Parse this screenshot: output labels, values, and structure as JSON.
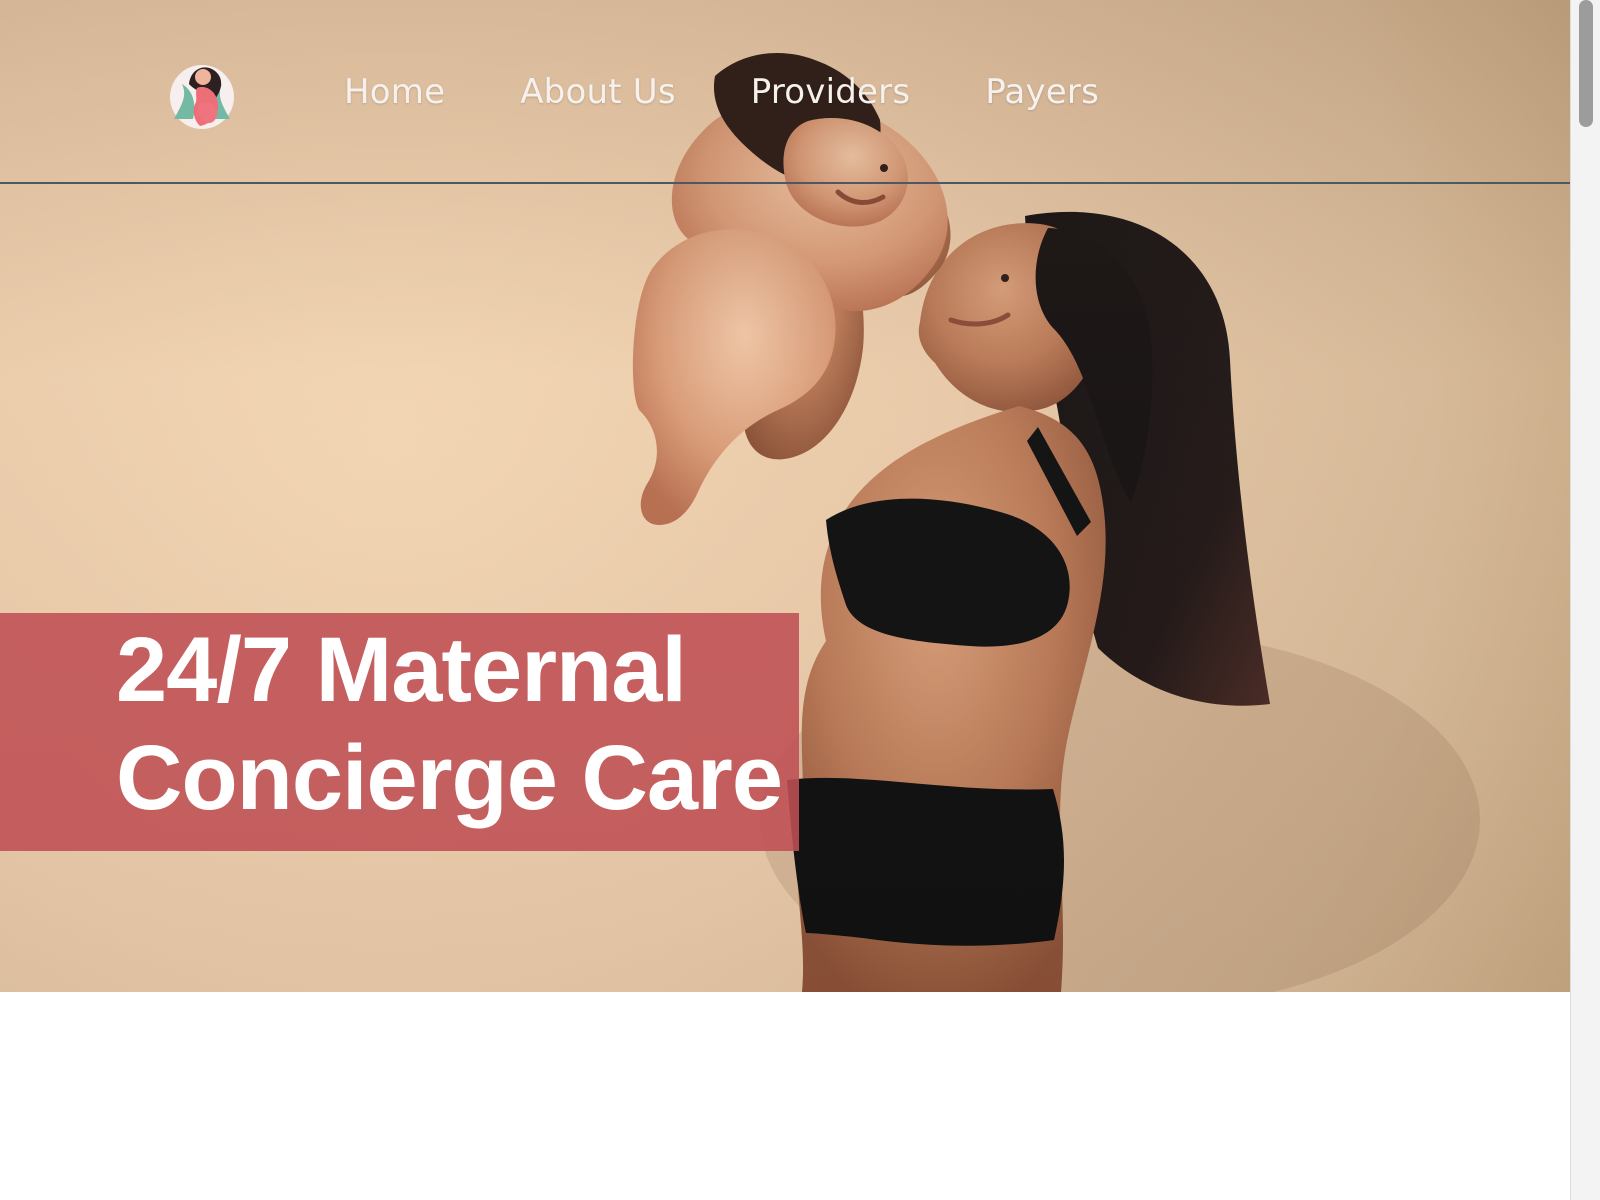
{
  "site": {
    "logo_icon": "pregnant-woman-logo-icon"
  },
  "nav": {
    "items": [
      {
        "label": "Home"
      },
      {
        "label": "About Us"
      },
      {
        "label": "Providers"
      },
      {
        "label": "Payers"
      }
    ]
  },
  "hero": {
    "headline_line1": "24/7 Maternal",
    "headline_line2": "Concierge Care",
    "image_icon": "mother-lifting-baby-photo"
  },
  "colors": {
    "header_divider": "#4d5961",
    "headline_box": "#bf5054",
    "headline_text": "#ffffff",
    "nav_text": "#f6f1ec"
  },
  "scrollbar": {
    "icon": "vertical-scrollbar-icon"
  }
}
